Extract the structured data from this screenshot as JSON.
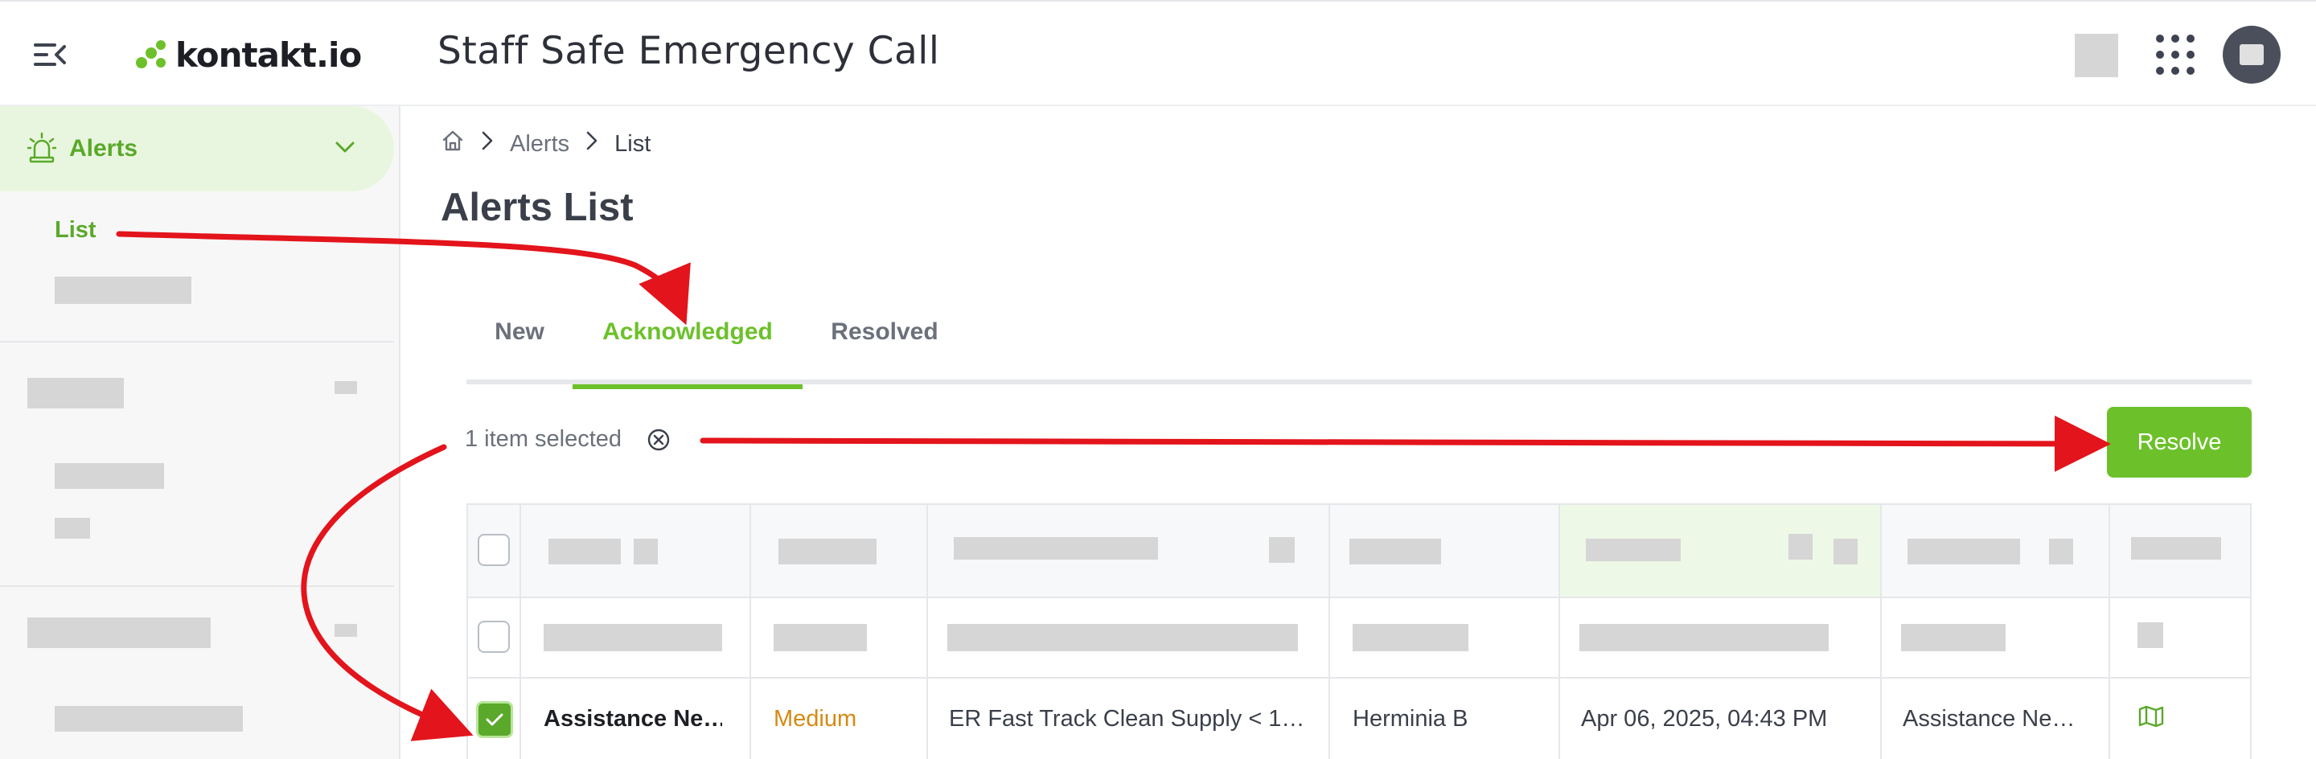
{
  "header": {
    "logo_text": "kontakt.io",
    "app_title": "Staff Safe Emergency Call",
    "icons": [
      "menu-collapse-icon",
      "apps-grid-icon",
      "user-avatar"
    ]
  },
  "sidebar": {
    "alerts_label": "Alerts",
    "list_label": "List"
  },
  "breadcrumb": {
    "home_icon": "home-icon",
    "items": [
      "Alerts",
      "List"
    ]
  },
  "page_title": "Alerts List",
  "tabs": [
    {
      "label": "New"
    },
    {
      "label": "Acknowledged",
      "active": true
    },
    {
      "label": "Resolved"
    }
  ],
  "selection": {
    "text": "1 item selected",
    "resolve_label": "Resolve"
  },
  "table": {
    "selected_row": {
      "checked": true,
      "name": "Assistance Ne…",
      "priority": "Medium",
      "location": "ER Fast Track Clean Supply < 1…",
      "staff": "Herminia B",
      "datetime": "Apr 06, 2025, 04:43 PM",
      "type": "Assistance Ne…",
      "map_icon": "map-icon"
    }
  },
  "colors": {
    "accent_green": "#6cc12a",
    "priority_medium": "#d48a12",
    "annotation_red": "#e3141b"
  }
}
